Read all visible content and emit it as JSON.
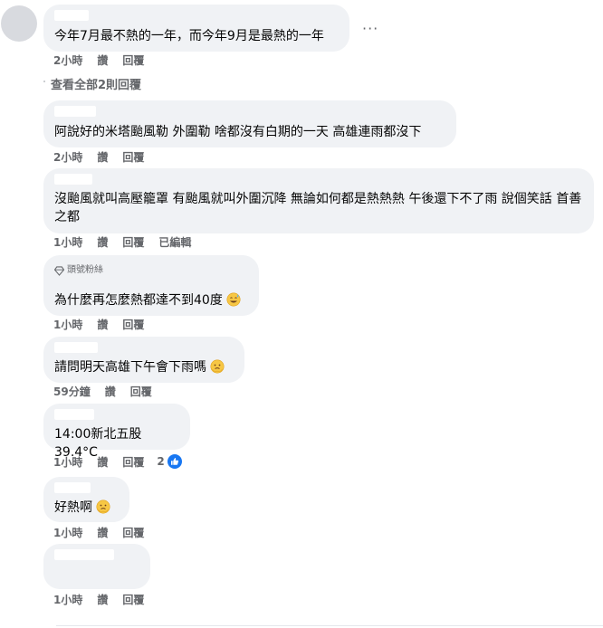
{
  "comments": [
    {
      "id": "c1",
      "text": "今年7月最不熱的一年，而今年9月是最熱的一年",
      "time": "2小時",
      "like_label": "讚",
      "reply_label": "回覆"
    },
    {
      "id": "c2",
      "text": "阿說好的米塔颱風勒 外圍勒 啥都沒有白期的一天 高雄連雨都沒下",
      "time": "2小時",
      "like_label": "讚",
      "reply_label": "回覆"
    },
    {
      "id": "c3",
      "text": "沒颱風就叫高壓籠罩 有颱風就叫外圍沉降 無論如何都是熱熱熱 午後還下不了雨 說個笑話 首善之都",
      "time": "1小時",
      "like_label": "讚",
      "reply_label": "回覆",
      "edited_label": "已編輯"
    },
    {
      "id": "c4",
      "badge": "頭號粉絲",
      "text": "為什麼再怎麼熱都達不到40度",
      "time": "1小時",
      "like_label": "讚",
      "reply_label": "回覆"
    },
    {
      "id": "c5",
      "text": "請問明天高雄下午會下雨嗎",
      "time": "59分鐘",
      "like_label": "讚",
      "reply_label": "回覆"
    },
    {
      "id": "c6",
      "text": "14:00新北五股39.4°C",
      "time": "1小時",
      "like_label": "讚",
      "reply_label": "回覆",
      "like_count": "2"
    },
    {
      "id": "c7",
      "text": "好熱啊",
      "time": "1小時",
      "like_label": "讚",
      "reply_label": "回覆"
    },
    {
      "id": "c8",
      "text": "",
      "time": "1小時",
      "like_label": "讚",
      "reply_label": "回覆"
    }
  ],
  "view_all_replies": "查看全部2則回覆",
  "more_options": "···",
  "colors": {
    "bubble": "#f0f2f5",
    "meta_text": "#65676b",
    "like_blue": "#1877f2"
  },
  "icons": {
    "more": "more-options-icon",
    "like": "like-reaction-icon",
    "fan_badge": "diamond-icon",
    "emoji_grin": "grinning-sweat-emoji",
    "emoji_hot": "hot-face-emoji"
  }
}
